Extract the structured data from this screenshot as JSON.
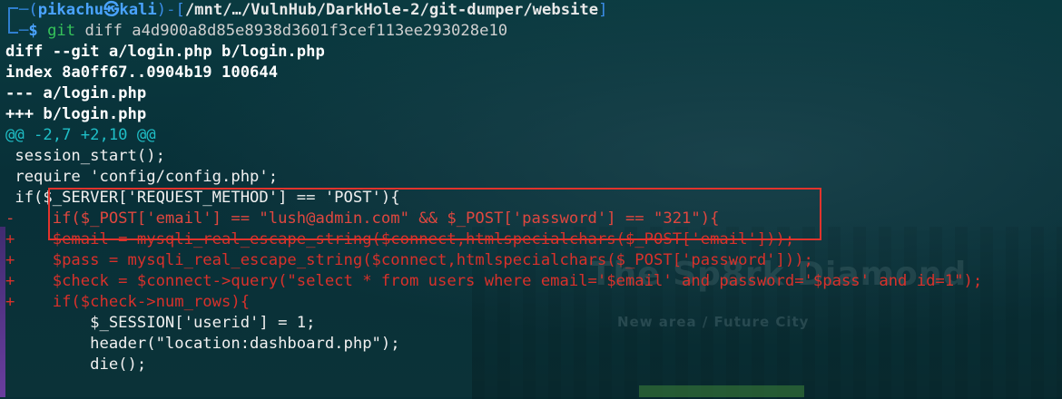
{
  "prompt": {
    "open_bracket": "(",
    "user_host": "pikachu㉿kali",
    "close_bracket": ")",
    "sep": "-",
    "path_open": "[",
    "path": "/mnt/…/VulnHub/DarkHole-2/git-dumper/website",
    "path_close": "]",
    "dollar": "$",
    "command_git": "git",
    "command_args": "diff a4d900a8d85e8938d3601f3cef113ee293028e10"
  },
  "diff_header": {
    "line1": "diff --git a/login.php b/login.php",
    "line2": "index 8a0ff67..0904b19 100644",
    "line3": "--- a/login.php",
    "line4": "+++ b/login.php",
    "hunk": "@@ -2,7 +2,10 @@"
  },
  "diff_lines": [
    {
      "kind": "ctx",
      "text": " session_start();"
    },
    {
      "kind": "ctx",
      "text": " require 'config/config.php';"
    },
    {
      "kind": "ctx",
      "text": " if($_SERVER['REQUEST_METHOD'] == 'POST'){"
    },
    {
      "kind": "del",
      "text": "-    if($_POST['email'] == \"lush@admin.com\" && $_POST['password'] == \"321\"){"
    },
    {
      "kind": "add",
      "text": "+    $email = mysqli_real_escape_string($connect,htmlspecialchars($_POST['email']));"
    },
    {
      "kind": "add",
      "text": "+    $pass = mysqli_real_escape_string($connect,htmlspecialchars($_POST['password']));"
    },
    {
      "kind": "add",
      "text": "+    $check = $connect->query(\"select * from users where email='$email' and password='$pass' and id=1\");"
    },
    {
      "kind": "add",
      "text": "+    if($check->num_rows){"
    },
    {
      "kind": "ctx",
      "text": "         $_SESSION['userid'] = 1;"
    },
    {
      "kind": "ctx",
      "text": "         header(\"location:dashboard.php\");"
    },
    {
      "kind": "ctx",
      "text": "         die();"
    }
  ],
  "wallpaper": {
    "title": "The Sp8rk Diamond",
    "subtitle": "New area / Future City"
  },
  "colors": {
    "background": "#082f36",
    "prompt_blue": "#3b8eea",
    "git_green": "#36c35a",
    "hunk_cyan": "#1fbfc7",
    "diff_red": "#d8312b",
    "highlight_box": "#e2332c"
  }
}
